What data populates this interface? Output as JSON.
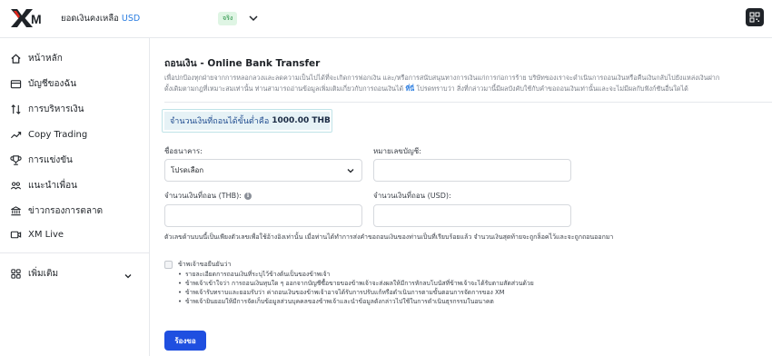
{
  "header": {
    "logo_text": "XM",
    "balance_label": "ยอดเงินคงเหลือ",
    "currency": "USD",
    "account_badge": "จริง",
    "qr_icon": "qr-code-icon"
  },
  "sidebar": {
    "items": [
      {
        "label": "หน้าหลัก",
        "icon": "home-icon"
      },
      {
        "label": "บัญชีของฉัน",
        "icon": "wallet-icon"
      },
      {
        "label": "การบริหารเงิน",
        "icon": "transfer-arrows-icon"
      },
      {
        "label": "Copy Trading",
        "icon": "trend-line-icon"
      },
      {
        "label": "การแข่งขัน",
        "icon": "trophy-icon"
      },
      {
        "label": "แนะนำเพื่อน",
        "icon": "users-icon"
      },
      {
        "label": "ข่าวกรองการตลาด",
        "icon": "bank-building-icon"
      },
      {
        "label": "XM Live",
        "icon": "video-icon"
      }
    ],
    "more": {
      "label": "เพิ่มเติม",
      "icon": "grid-icon"
    }
  },
  "main": {
    "title": "ถอนเงิน - Online Bank Transfer",
    "disclaimer_part1": "เพื่อปกป้องทุกฝ่ายจากการหลอกลวงและลดความเป็นไปได้ที่จะเกิดการฟอกเงิน และ/หรือการสนับสนุนทางการเงินแก่การก่อการร้าย บริษัทของเราจะดำเนินการถอนเงินหรือคืนเงินกลับไปยังแหล่งเงินฝาก",
    "disclaimer_part2": "ดั้งเดิมตามกฎที่เหมาะสมเท่านั้น ท่านสามารถอ่านข้อมูลเพิ่มเติมเกี่ยวกับการถอนเงินได้",
    "disclaimer_link": "ที่นี่",
    "disclaimer_part3": "โปรดทราบว่า สิ่งที่กล่าวมานี้มีผลบังคับใช้กับคำขอถอนเงินเท่านั้นและจะไม่มีผลกับฟังก์ชันอื่นใดได้",
    "min_withdraw_label": "จำนวนเงินที่ถอนได้ขั้นต่ำคือ",
    "min_withdraw_value": "1000.00 THB",
    "bank_name_label": "ชื่อธนาคาร:",
    "bank_select_value": "โปรดเลือก",
    "account_number_label": "หมายเลขบัญชี:",
    "amount_thb_label": "จำนวนเงินที่ถอน (THB):",
    "amount_usd_label": "จำนวนเงินที่ถอน (USD):",
    "note": "ตัวเลขด้านบนนี้เป็นเพียงตัวเลขเพื่อใช้อ้างอิงเท่านั้น เมื่อท่านได้ทำการส่งคำขอถอนเงินของท่านเป็นที่เรียบร้อยแล้ว จำนวนเงินสุดท้ายจะถูกล็อคไว้และจะถูกถอนออกมา",
    "consent_title": "ข้าพเจ้าขอยืนยันว่า",
    "consent_bullets": [
      "รายละเอียดการถอนเงินที่ระบุไว้ข้างต้นเป็นของข้าพเจ้า",
      "ข้าพเจ้าเข้าใจว่า การถอนเงินทุนใด ๆ ออกจากบัญชีซื้อขายของข้าพเจ้าจะส่งผลให้มีการหักลบโบนัสที่ข้าพเจ้าจะได้รับตามสัดส่วนด้วย",
      "ข้าพเจ้ารับทราบและยอมรับว่า ค่าถอนเงินของข้าพเจ้าอาจได้รับการปรับแก้หรือดำเนินการตามขั้นตอนการจัดการของ XM",
      "ข้าพเจ้ายินยอมให้มีการจัดเก็บข้อมูลส่วนบุคคลของข้าพเจ้าและนำข้อมูลดังกล่าวไปใช้ในการดำเนินธุรกรรมในอนาคต"
    ],
    "submit_label": "ร้องขอ"
  },
  "colors": {
    "accent_blue": "#1f4fe0",
    "link_blue": "#2a7de1",
    "badge_green": "#1a8a3a",
    "info_bg": "#e6f2f6"
  }
}
